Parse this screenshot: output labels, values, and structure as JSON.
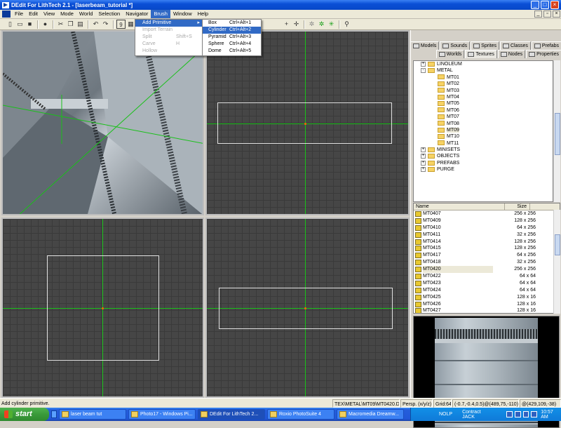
{
  "window": {
    "title": "DEdit For LithTech 2.1 - [laserbeam_tutorial *]",
    "minimize": "_",
    "maximize": "□",
    "close": "×"
  },
  "menu": {
    "items": [
      "File",
      "Edit",
      "View",
      "Mode",
      "World",
      "Selection",
      "Navigator",
      "Brush",
      "Window",
      "Help"
    ],
    "active": "Brush"
  },
  "brush_menu": {
    "items": [
      {
        "label": "Add Primitive",
        "shortcut": "",
        "state": "highlighted",
        "submenu": true
      },
      {
        "label": "Import Terrain",
        "shortcut": "",
        "state": "disabled"
      },
      {
        "label": "Split",
        "shortcut": "Shift+S",
        "state": "disabled"
      },
      {
        "label": "Carve",
        "shortcut": "H",
        "state": "disabled"
      },
      {
        "label": "Hollow",
        "shortcut": "",
        "state": "disabled"
      }
    ]
  },
  "primitive_menu": {
    "items": [
      {
        "label": "Box",
        "shortcut": "Ctrl+Alt+1"
      },
      {
        "label": "Cylinder",
        "shortcut": "Ctrl+Alt+2",
        "highlighted": true
      },
      {
        "label": "Pyramid",
        "shortcut": "Ctrl+Alt+3"
      },
      {
        "label": "Sphere",
        "shortcut": "Ctrl+Alt+4"
      },
      {
        "label": "Dome",
        "shortcut": "Ctrl+Alt+5"
      }
    ]
  },
  "toolbar": {
    "zoom_value": "9"
  },
  "panel": {
    "tabs_top": [
      "Models",
      "Sounds",
      "Sprites",
      "Classes",
      "Prefabs"
    ],
    "tabs_bottom": [
      "Worlds",
      "Textures",
      "Nodes",
      "Properties"
    ],
    "active_tab": "Textures",
    "tree": [
      {
        "label": "LINOLEUM",
        "depth": 0,
        "exp": "+"
      },
      {
        "label": "METAL",
        "depth": 0,
        "exp": "-"
      },
      {
        "label": "MT01",
        "depth": 1
      },
      {
        "label": "MT02",
        "depth": 1
      },
      {
        "label": "MT03",
        "depth": 1
      },
      {
        "label": "MT04",
        "depth": 1
      },
      {
        "label": "MT05",
        "depth": 1
      },
      {
        "label": "MT06",
        "depth": 1
      },
      {
        "label": "MT07",
        "depth": 1
      },
      {
        "label": "MT08",
        "depth": 1
      },
      {
        "label": "MT09",
        "depth": 1,
        "selected": true
      },
      {
        "label": "MT10",
        "depth": 1
      },
      {
        "label": "MT11",
        "depth": 1
      },
      {
        "label": "MINISETS",
        "depth": 0,
        "exp": "+"
      },
      {
        "label": "OBJECTS",
        "depth": 0,
        "exp": "+"
      },
      {
        "label": "PREFABS",
        "depth": 0,
        "exp": "+"
      },
      {
        "label": "PURGE",
        "depth": 0,
        "exp": "+"
      }
    ],
    "list_headers": {
      "name": "Name",
      "size": "Size"
    },
    "textures": [
      {
        "name": "MT0407",
        "size": "256 x 256"
      },
      {
        "name": "MT0409",
        "size": "128 x 256"
      },
      {
        "name": "MT0410",
        "size": "64 x 256"
      },
      {
        "name": "MT0411",
        "size": "32 x 256"
      },
      {
        "name": "MT0414",
        "size": "128 x 256"
      },
      {
        "name": "MT0415",
        "size": "128 x 256"
      },
      {
        "name": "MT0417",
        "size": "64 x 256"
      },
      {
        "name": "MT0418",
        "size": "32 x 256"
      },
      {
        "name": "MT0420",
        "size": "256 x 256",
        "selected": true
      },
      {
        "name": "MT0422",
        "size": "64 x 64"
      },
      {
        "name": "MT0423",
        "size": "64 x 64"
      },
      {
        "name": "MT0424",
        "size": "64 x 64"
      },
      {
        "name": "MT0425",
        "size": "128 x 16"
      },
      {
        "name": "MT0426",
        "size": "128 x 16"
      },
      {
        "name": "MT0427",
        "size": "128 x 16"
      }
    ]
  },
  "status": {
    "message": "Add cylinder primitive.",
    "texture": "TEX\\METAL\\MT09\\MT0420.DTX",
    "view": "Persp. (x/y/z)",
    "grid": "Grid:64",
    "coords1": "(-0.7,-0.4,0.5)@(489,75,-110)",
    "coords2": "@(429,109,-38)"
  },
  "taskbar": {
    "start": "start",
    "tasks": [
      {
        "label": "laser beam tut"
      },
      {
        "label": "Photo17 - Windows Pi..."
      },
      {
        "label": "DEdit For LithTech 2...",
        "active": true
      },
      {
        "label": "Roxio PhotoSuite 4"
      },
      {
        "label": "Macromedia Dreamw..."
      }
    ],
    "tray_text1": "NOLP",
    "tray_text2": "Contract JACK",
    "clock": "10:57 AM"
  }
}
